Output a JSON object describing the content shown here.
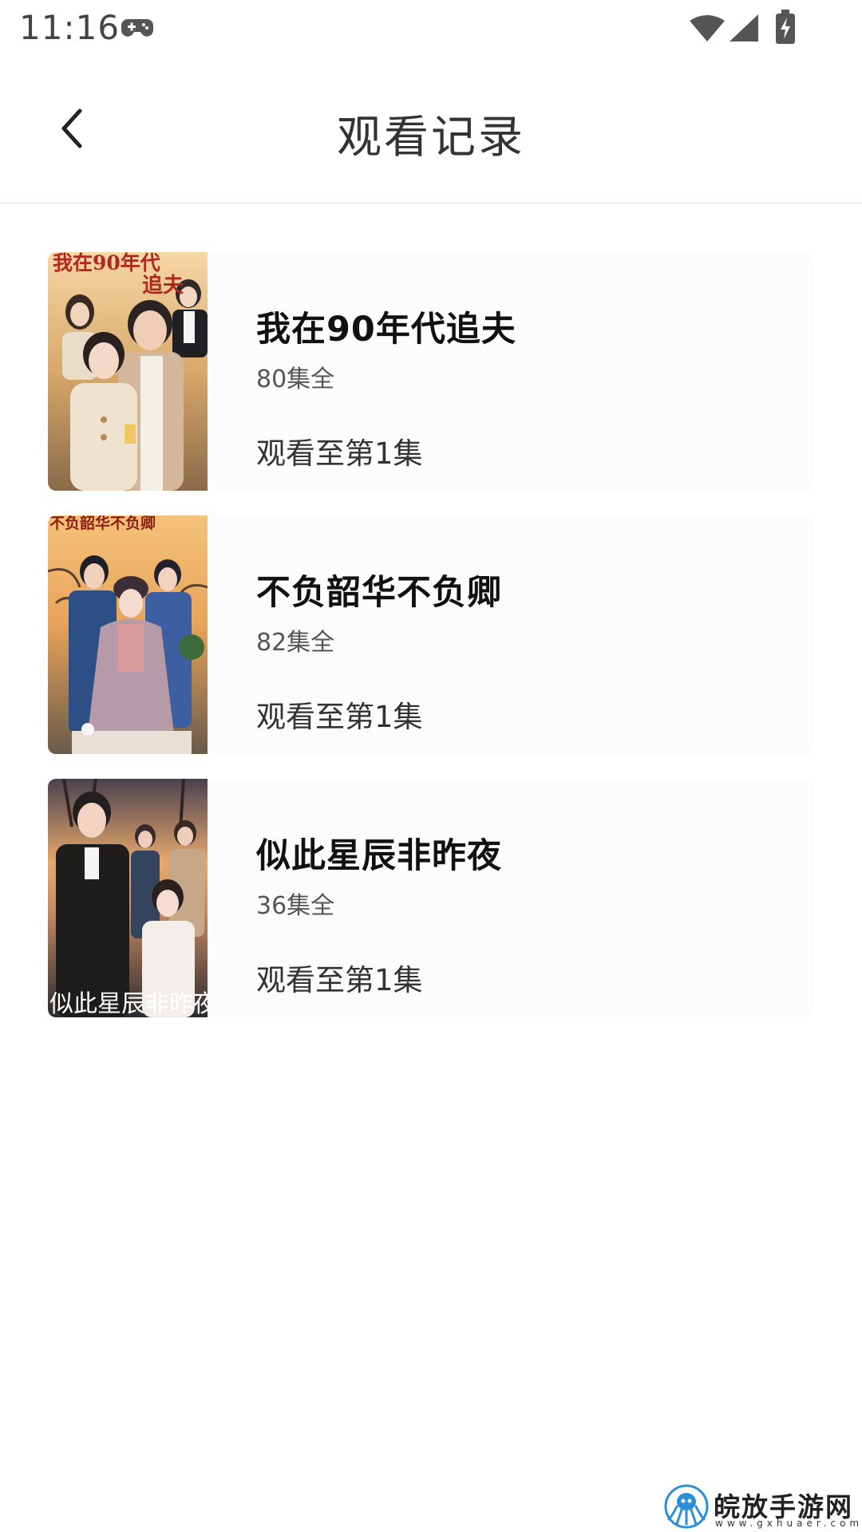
{
  "status_bar": {
    "time": "11:16",
    "icons": [
      "gamepad-icon",
      "wifi-icon",
      "signal-icon",
      "battery-charging-icon"
    ]
  },
  "header": {
    "back_icon": "chevron-left-icon",
    "title": "观看记录"
  },
  "history": [
    {
      "title": "我在90年代追夫",
      "episodes": "80集全",
      "progress": "观看至第1集",
      "poster_text": "我在90年代追夫"
    },
    {
      "title": "不负韶华不负卿",
      "episodes": "82集全",
      "progress": "观看至第1集",
      "poster_text": "不负韶华不负卿"
    },
    {
      "title": "似此星辰非昨夜",
      "episodes": "36集全",
      "progress": "观看至第1集",
      "poster_text": "似此星辰非昨夜"
    }
  ],
  "watermark": {
    "name": "皖放手游网",
    "url": "www.gxhuaer.com"
  },
  "colors": {
    "background": "#ffffff",
    "card_background": "#fcfcfc",
    "divider": "#e6e6e6",
    "title_text": "#111111",
    "secondary_text": "#555555"
  }
}
